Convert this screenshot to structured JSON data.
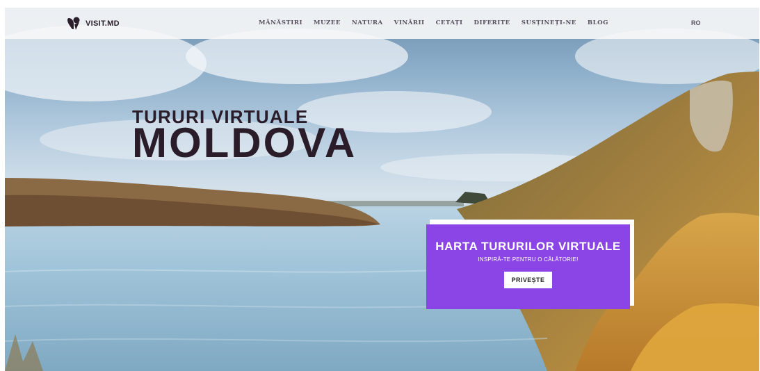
{
  "brand": {
    "name": "VISIT.MD",
    "icon": "map-pin-logo"
  },
  "nav": {
    "items": [
      "MĂNĂSTIRI",
      "MUZEE",
      "NATURA",
      "VINĂRII",
      "CETAȚI",
      "DIFERITE",
      "SUSȚINEȚI-NE",
      "BLOG"
    ],
    "language": "RO"
  },
  "hero": {
    "subtitle": "TURURI VIRTUALE",
    "title": "MOLDOVA"
  },
  "map_card": {
    "title": "HARTA TURURILOR VIRTUALE",
    "subtitle": "INSPIRĂ-TE PENTRU O CĂLĂTORIE!",
    "button_label": "PRIVEȘTE",
    "color": "#8b45e6"
  },
  "colors": {
    "nav_background": "#f5f6f8",
    "title_text": "#2a1c28",
    "accent": "#8b45e6"
  }
}
